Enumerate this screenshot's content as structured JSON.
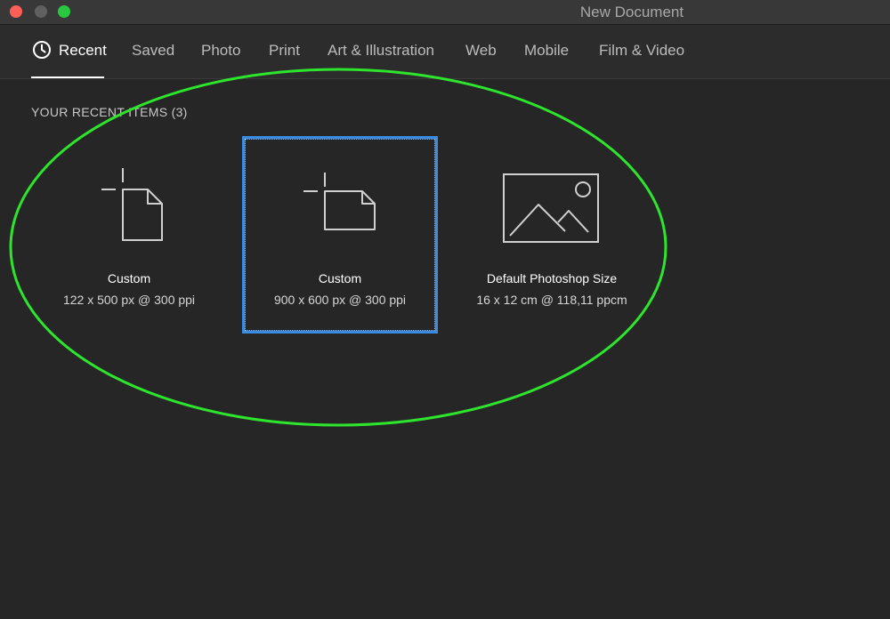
{
  "window": {
    "title": "New Document"
  },
  "tabs": [
    {
      "label": "Recent",
      "active": true
    },
    {
      "label": "Saved"
    },
    {
      "label": "Photo"
    },
    {
      "label": "Print"
    },
    {
      "label": "Art & Illustration"
    },
    {
      "label": "Web"
    },
    {
      "label": "Mobile"
    },
    {
      "label": "Film & Video"
    }
  ],
  "recent": {
    "header": "YOUR RECENT ITEMS  (3)",
    "items": [
      {
        "title": "Custom",
        "subtitle": "122 x 500 px @ 300 ppi",
        "icon": "portrait-document-icon"
      },
      {
        "title": "Custom",
        "subtitle": "900 x 600 px @ 300 ppi",
        "icon": "landscape-document-icon",
        "selected": true
      },
      {
        "title": "Default Photoshop Size",
        "subtitle": "16 x 12 cm @ 118,11 ppcm",
        "icon": "image-placeholder-icon"
      }
    ]
  },
  "colors": {
    "background": "#262626",
    "accent_selection": "#3d8be0",
    "annotation": "#2ee52e"
  }
}
